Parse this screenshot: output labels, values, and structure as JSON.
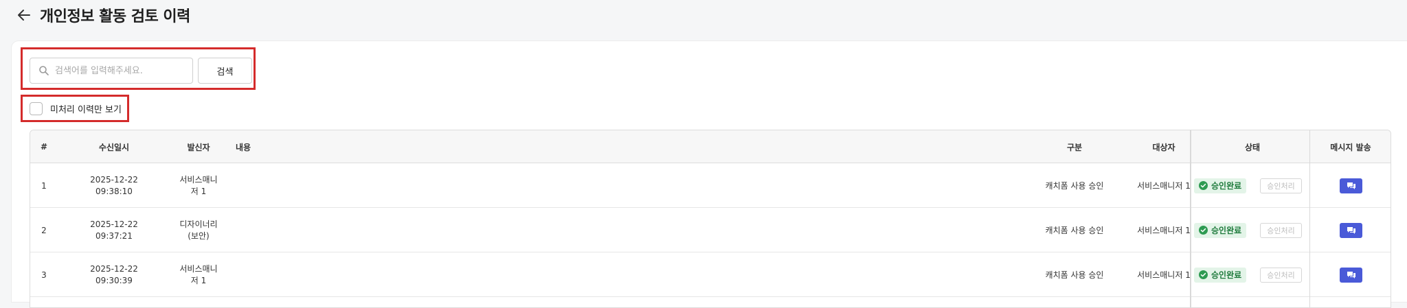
{
  "header": {
    "title": "개인정보 활동 검토 이력",
    "back_icon": "arrow-left-icon"
  },
  "search": {
    "placeholder": "검색어를 입력해주세요.",
    "value": "",
    "button_label": "검색",
    "icon": "search-icon"
  },
  "filter": {
    "label": "미처리 이력만 보기",
    "checked": false
  },
  "table": {
    "columns": {
      "num": "#",
      "received": "수신일시",
      "sender": "발신자",
      "content": "내용",
      "category": "구분",
      "target": "대상자",
      "status": "상태",
      "message": "메시지 발송"
    },
    "rows": [
      {
        "num": "1",
        "date": "2025-12-22",
        "time": "09:38:10",
        "sender_l1": "서비스매니",
        "sender_l2": "저 1",
        "content": "",
        "category": "캐치폼 사용 승인",
        "target": "서비스매니저 1",
        "status_badge": "승인완료",
        "action_label": "승인처리"
      },
      {
        "num": "2",
        "date": "2025-12-22",
        "time": "09:37:21",
        "sender_l1": "디자이너리",
        "sender_l2": "(보안)",
        "content": "",
        "category": "캐치폼 사용 승인",
        "target": "서비스매니저 1",
        "status_badge": "승인완료",
        "action_label": "승인처리"
      },
      {
        "num": "3",
        "date": "2025-12-22",
        "time": "09:30:39",
        "sender_l1": "서비스매니",
        "sender_l2": "저 1",
        "content": "",
        "category": "캐치폼 사용 승인",
        "target": "서비스매니저 1",
        "status_badge": "승인완료",
        "action_label": "승인처리"
      }
    ]
  },
  "colors": {
    "accent": "#4a5ad8",
    "success_bg": "#e3f4e8",
    "success_text": "#1d7a3b",
    "highlight": "#d42b2b"
  }
}
